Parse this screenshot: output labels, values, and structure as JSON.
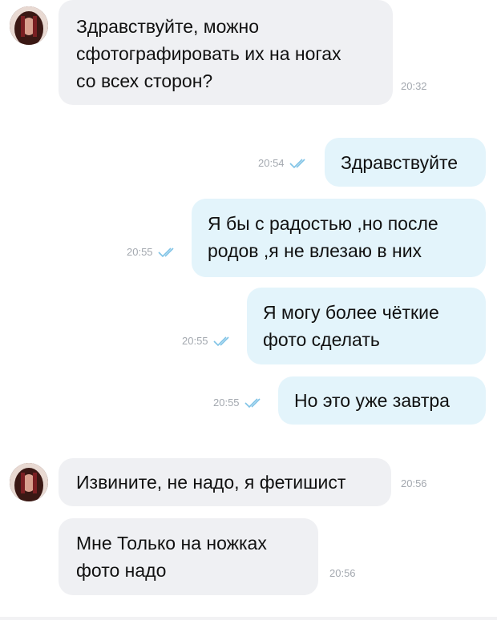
{
  "messages": [
    {
      "text": "Здравствуйте, можно\nсфотографировать их на ногах\nсо всех сторон?",
      "time": "20:32"
    },
    {
      "text": "Здравствуйте",
      "time": "20:54"
    },
    {
      "text": "Я бы с радостью ,но после\nродов ,я не влезаю в них",
      "time": "20:55"
    },
    {
      "text": "Я могу более чёткие\nфото сделать",
      "time": "20:55"
    },
    {
      "text": "Но это уже завтра",
      "time": "20:55"
    },
    {
      "text": "Извините, не надо, я фетишист",
      "time": "20:56"
    },
    {
      "text": "Мне Только на ножках\nфото надо",
      "time": "20:56"
    }
  ],
  "icons": {
    "read_receipt": "double-check-icon",
    "avatar": "contact-avatar"
  },
  "colors": {
    "incoming_bubble": "#eff0f3",
    "outgoing_bubble": "#e3f4fb",
    "timestamp": "#a3a8af",
    "check_marks": "#7fc3e6"
  }
}
